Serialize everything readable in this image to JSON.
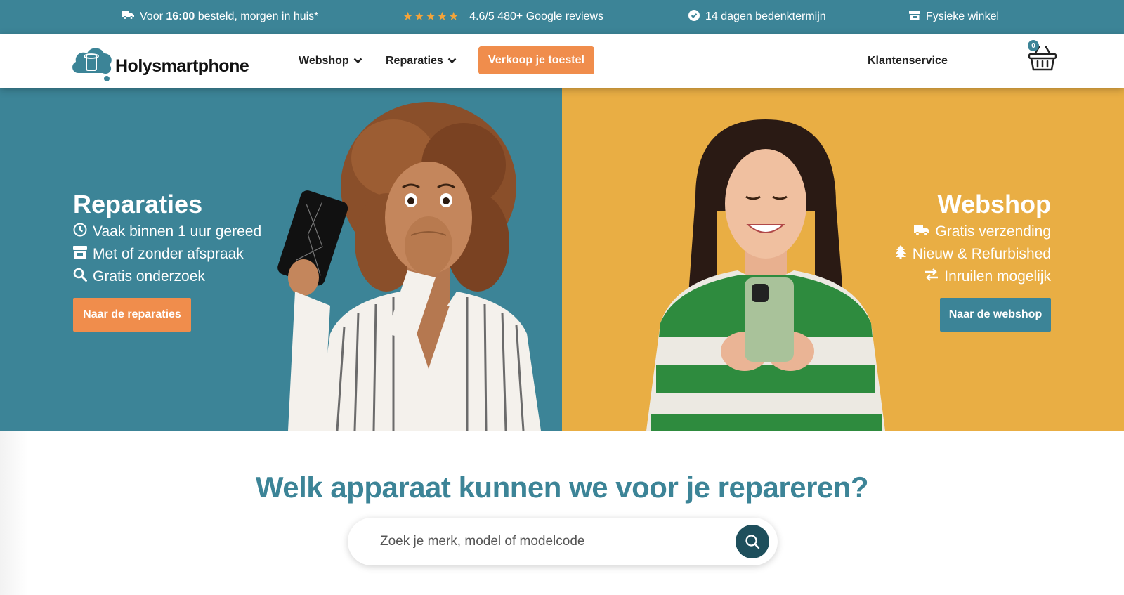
{
  "colors": {
    "teal": "#3c8497",
    "orange": "#f08d4c",
    "yellow": "#e9ae44",
    "dark_teal": "#1e4f5c"
  },
  "topbar": {
    "delivery_prefix": "Voor",
    "delivery_time": "16:00",
    "delivery_suffix": "besteld, morgen in huis*",
    "stars": "★★★★★",
    "reviews": "4.6/5 480+ Google reviews",
    "return_policy": "14 dagen bedenktermijn",
    "store": "Fysieke winkel",
    "icons": [
      "truck-icon",
      "star-icon",
      "check-circle-icon",
      "store-icon"
    ]
  },
  "header": {
    "logo_text": "Holysmartphone",
    "nav": {
      "webshop": "Webshop",
      "reparaties": "Reparaties",
      "sell": "Verkoop je toestel",
      "service": "Klantenservice"
    },
    "cart_count": "0"
  },
  "hero_left": {
    "title": "Reparaties",
    "features": [
      "Vaak binnen 1 uur gereed",
      "Met of zonder afspraak",
      "Gratis onderzoek"
    ],
    "feature_icons": [
      "clock-icon",
      "store-icon",
      "search-icon"
    ],
    "button": "Naar de reparaties"
  },
  "hero_right": {
    "title": "Webshop",
    "features": [
      "Gratis verzending",
      "Nieuw & Refurbished",
      "Inruilen mogelijk"
    ],
    "feature_icons": [
      "truck-icon",
      "tree-icon",
      "swap-icon"
    ],
    "button": "Naar de webshop"
  },
  "search": {
    "heading": "Welk apparaat kunnen we voor je repareren?",
    "placeholder": "Zoek je merk, model of modelcode"
  }
}
